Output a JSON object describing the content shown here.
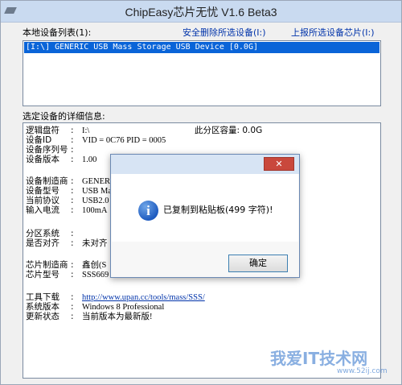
{
  "window": {
    "title": "ChipEasy芯片无忧 V1.6 Beta3"
  },
  "top": {
    "device_list_label": "本地设备列表(1):",
    "safe_remove_link": "安全删除所选设备(I:)",
    "report_link": "上报所选设备芯片(I:)",
    "devices": [
      "[I:\\] GENERIC USB Mass Storage USB Device [0.0G]"
    ]
  },
  "details": {
    "label": "选定设备的详细信息:",
    "rows": [
      {
        "key": "逻辑盘符",
        "sep": ":",
        "value": "I:\\",
        "extra": "此分区容量:  0.0G"
      },
      {
        "key": "设备ID",
        "sep": ":",
        "value": "VID = 0C76      PID = 0005"
      },
      {
        "key": "设备序列号",
        "sep": ":",
        "value": ""
      },
      {
        "key": "设备版本",
        "sep": ":",
        "value": "1.00"
      },
      {
        "key": "设备制造商",
        "sep": ":",
        "value": "GENERI"
      },
      {
        "key": "设备型号",
        "sep": ":",
        "value": "USB Ma"
      },
      {
        "key": "当前协议",
        "sep": ":",
        "value": "USB2.0"
      },
      {
        "key": "输入电流",
        "sep": ":",
        "value": "100mA"
      },
      {
        "key": "分区系统",
        "sep": ":",
        "value": ""
      },
      {
        "key": "是否对齐",
        "sep": ":",
        "value": "未对齐"
      },
      {
        "key": "芯片制造商",
        "sep": ":",
        "value": "鑫创(S"
      },
      {
        "key": "芯片型号",
        "sep": ":",
        "value": "SSS669"
      },
      {
        "key": "工具下载",
        "sep": ":",
        "value": "http://www.upan.cc/tools/mass/SSS/"
      },
      {
        "key": "系统版本",
        "sep": ":",
        "value": "Windows 8 Professional"
      },
      {
        "key": "更新状态",
        "sep": ":",
        "value": "当前版本为最新版!"
      }
    ]
  },
  "dialog": {
    "close_label": "✕",
    "message": "已复制到粘贴板(499 字符)!",
    "ok_label": "确定",
    "icon_glyph": "i"
  },
  "watermark": {
    "text": "我爱IT技术网",
    "url": "www.52ij.com"
  }
}
